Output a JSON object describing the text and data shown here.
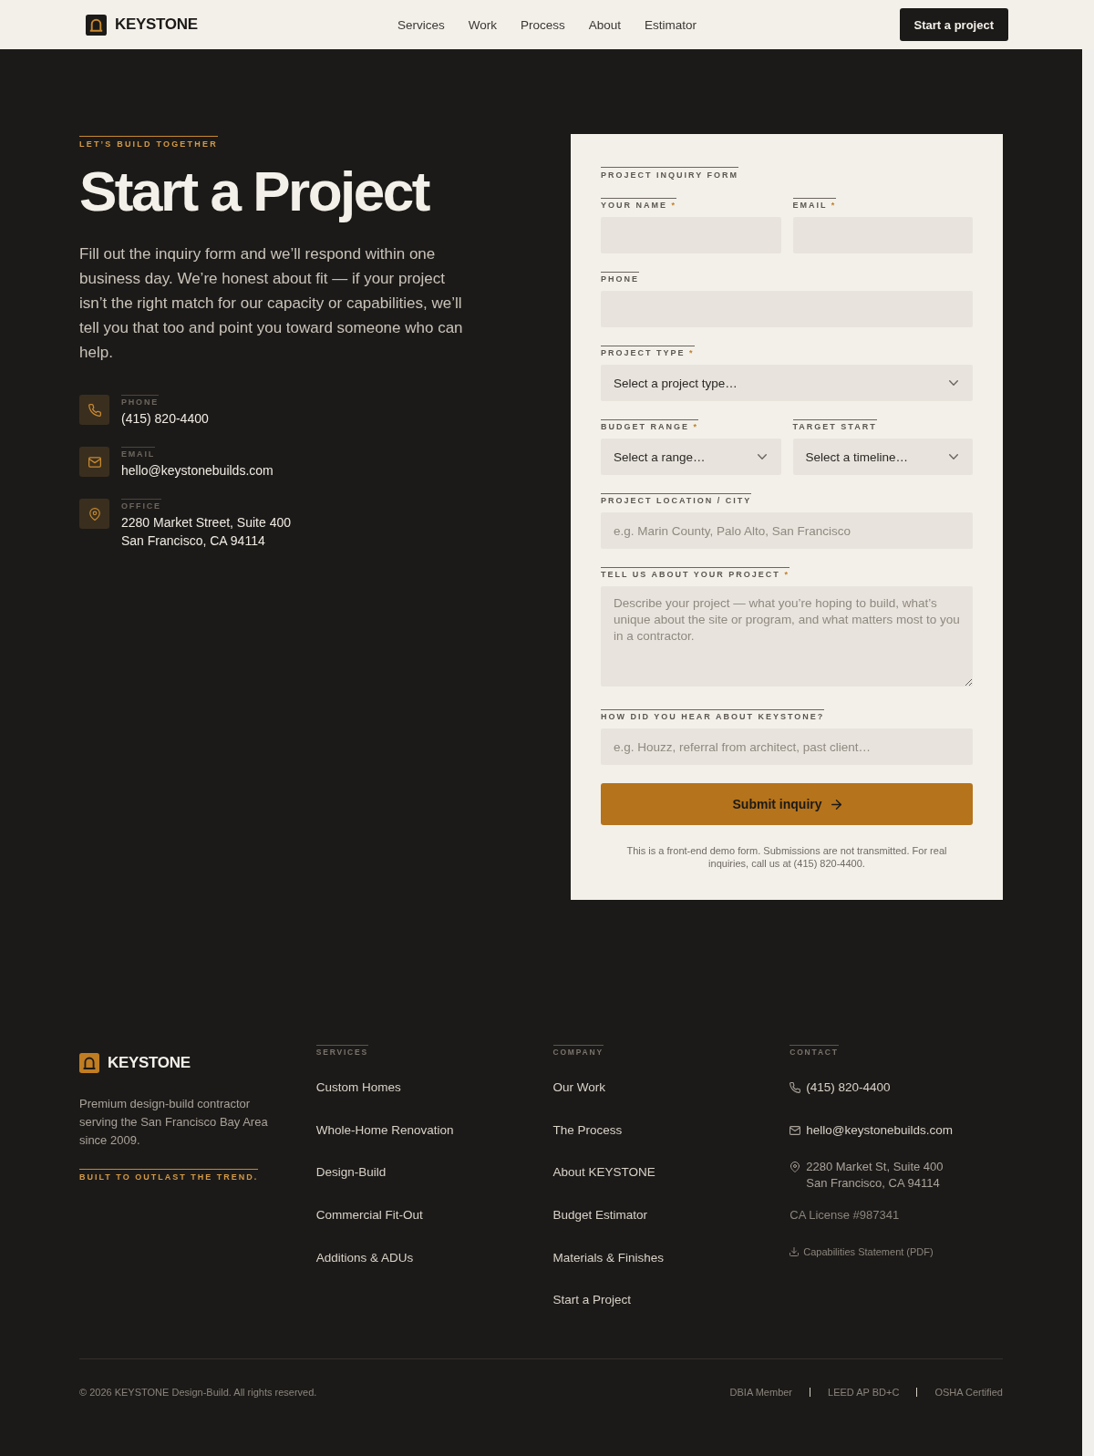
{
  "header": {
    "brand": "KEYSTONE",
    "nav": [
      "Services",
      "Work",
      "Process",
      "About",
      "Estimator"
    ],
    "cta": "Start a project"
  },
  "hero": {
    "eyebrow": "LET’S BUILD TOGETHER",
    "title": "Start a Project",
    "intro": "Fill out the inquiry form and we’ll respond within one business day. We’re honest about fit — if your project isn’t the right match for our capacity or capabilities, we’ll tell you that too and point you toward someone who can help.",
    "contacts": [
      {
        "kind": "phone",
        "label": "PHONE",
        "lines": [
          "(415) 820-4400"
        ]
      },
      {
        "kind": "email",
        "label": "EMAIL",
        "lines": [
          "hello@keystonebuilds.com"
        ]
      },
      {
        "kind": "office",
        "label": "OFFICE",
        "lines": [
          "2280 Market Street, Suite 400",
          "San Francisco, CA 94114"
        ]
      }
    ]
  },
  "form": {
    "title": "PROJECT INQUIRY FORM",
    "rows": [
      [
        {
          "kind": "input",
          "label": "YOUR NAME",
          "mark": "*"
        },
        {
          "kind": "input",
          "label": "EMAIL",
          "mark": "*"
        }
      ],
      [
        {
          "kind": "input",
          "label": "PHONE"
        }
      ],
      [
        {
          "kind": "select",
          "label": "PROJECT TYPE",
          "mark": "*",
          "value": "Select a project type…"
        }
      ],
      [
        {
          "kind": "select",
          "label": "BUDGET RANGE",
          "mark": "*",
          "value": "Select a range…"
        },
        {
          "kind": "select",
          "label": "TARGET START",
          "value": "Select a timeline…"
        }
      ],
      [
        {
          "kind": "input",
          "label": "PROJECT LOCATION / CITY",
          "placeholder": "e.g. Marin County, Palo Alto, San Francisco"
        }
      ],
      [
        {
          "kind": "textarea",
          "label": "TELL US ABOUT YOUR PROJECT",
          "mark": "*",
          "placeholder": "Describe your project — what you’re hoping to build, what’s unique about the site or program, and what matters most to you in a contractor."
        }
      ],
      [
        {
          "kind": "input",
          "label": "HOW DID YOU HEAR ABOUT KEYSTONE?",
          "placeholder": "e.g. Houzz, referral from architect, past client…"
        }
      ]
    ],
    "submit": "Submit inquiry",
    "note": "This is a front-end demo form. Submissions are not transmitted. For real inquiries, call us at (415) 820-4400."
  },
  "footer": {
    "brand": "KEYSTONE",
    "description": "Premium design-build contractor serving the San Francisco Bay Area since 2009.",
    "tagline": "BUILT TO OUTLAST THE TREND.",
    "columns": [
      {
        "heading": "SERVICES",
        "links": [
          "Custom Homes",
          "Whole-Home Renovation",
          "Design-Build",
          "Commercial Fit-Out",
          "Additions & ADUs"
        ]
      },
      {
        "heading": "COMPANY",
        "links": [
          "Our Work",
          "The Process",
          "About KEYSTONE",
          "Budget Estimator",
          "Materials & Finishes",
          "Start a Project"
        ]
      }
    ],
    "contact": {
      "heading": "CONTACT",
      "items": [
        {
          "kind": "phone",
          "lines": [
            "(415) 820-4400"
          ]
        },
        {
          "kind": "email",
          "lines": [
            "hello@keystonebuilds.com"
          ]
        },
        {
          "kind": "address",
          "lines": [
            "2280 Market St, Suite 400",
            "San Francisco, CA 94114"
          ]
        },
        {
          "kind": "license",
          "lines": [
            "CA License #987341"
          ]
        },
        {
          "kind": "download",
          "lines": [
            "Capabilities Statement (PDF)"
          ]
        }
      ]
    },
    "copyright": "© 2026 KEYSTONE Design-Build. All rights reserved.",
    "certifications": [
      "DBIA Member",
      "LEED AP BD+C",
      "OSHA Certified"
    ]
  }
}
